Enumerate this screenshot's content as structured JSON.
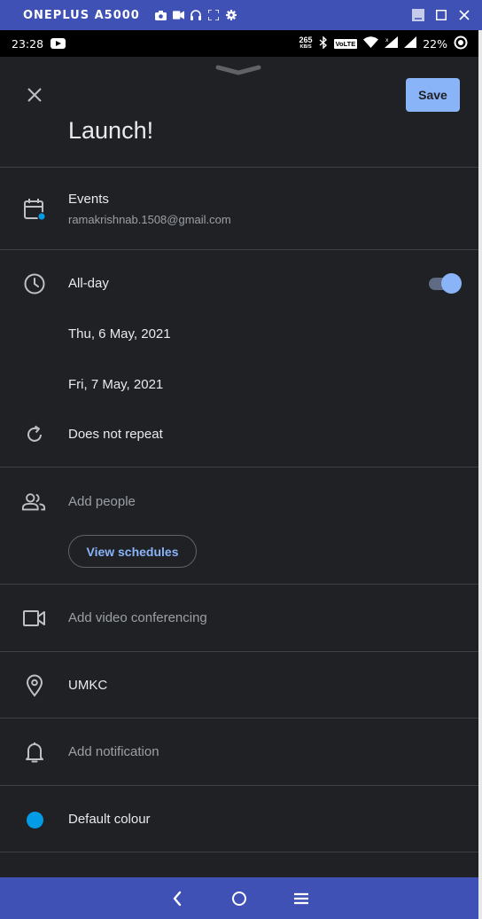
{
  "window": {
    "device_name": "ONEPLUS A5000"
  },
  "status_bar": {
    "time": "23:28",
    "net_speed_value": "265",
    "net_speed_unit": "KB/S",
    "volte": "VoLTE",
    "battery": "22%"
  },
  "header": {
    "save_label": "Save",
    "title": "Launch!"
  },
  "calendar": {
    "name": "Events",
    "account": "ramakrishnab.1508@gmail.com"
  },
  "time": {
    "all_day_label": "All-day",
    "all_day_on": true,
    "start_date": "Thu, 6 May, 2021",
    "end_date": "Fri, 7 May, 2021",
    "repeat": "Does not repeat"
  },
  "people": {
    "placeholder": "Add people",
    "view_schedules": "View schedules"
  },
  "video": {
    "placeholder": "Add video conferencing"
  },
  "location": {
    "value": "UMKC"
  },
  "notification": {
    "placeholder": "Add notification"
  },
  "colour": {
    "label": "Default colour",
    "value": "#039be5"
  },
  "colors": {
    "accent": "#8ab4f8",
    "background": "#202124",
    "nav_bar": "#3f51b5"
  }
}
